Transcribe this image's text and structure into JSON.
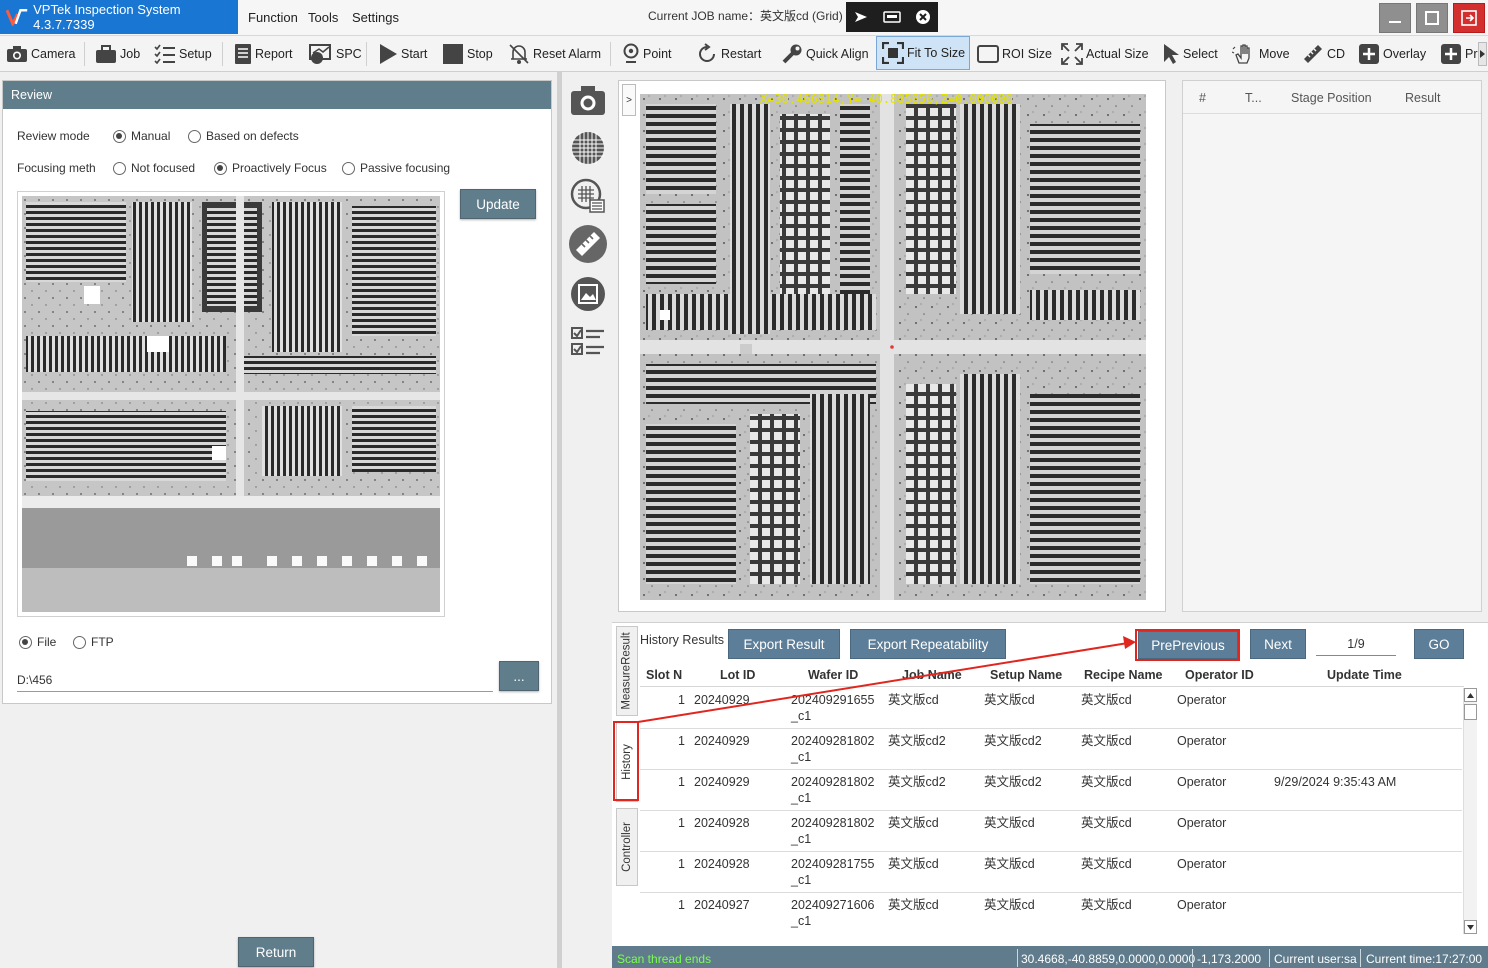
{
  "app": {
    "title": "VPTek Inspection System 4.3.7.7339",
    "menus": [
      "Function",
      "Tools",
      "Settings"
    ],
    "job_label": "Current JOB name：英文版cd (Grid)"
  },
  "toolbar": [
    {
      "id": "camera",
      "label": "Camera",
      "icon": "camera-icon"
    },
    {
      "id": "job",
      "label": "Job",
      "icon": "briefcase-icon"
    },
    {
      "id": "setup",
      "label": "Setup",
      "icon": "checklist-icon"
    },
    {
      "id": "report",
      "label": "Report",
      "icon": "report-icon"
    },
    {
      "id": "spc",
      "label": "SPC",
      "icon": "spc-icon"
    },
    {
      "id": "start",
      "label": "Start",
      "icon": "play-icon"
    },
    {
      "id": "stop",
      "label": "Stop",
      "icon": "stop-icon"
    },
    {
      "id": "reset_alarm",
      "label": "Reset Alarm",
      "icon": "bell-off-icon"
    },
    {
      "id": "point",
      "label": "Point",
      "icon": "pin-icon"
    },
    {
      "id": "restart",
      "label": "Restart",
      "icon": "restart-icon"
    },
    {
      "id": "quick_align",
      "label": "Quick Align",
      "icon": "wrench-icon"
    },
    {
      "id": "fit_to_size",
      "label": "Fit To Size",
      "icon": "fit-icon"
    },
    {
      "id": "roi_size",
      "label": "ROI Size",
      "icon": "rectangle-icon"
    },
    {
      "id": "actual_size",
      "label": "Actual Size",
      "icon": "expand-icon"
    },
    {
      "id": "select",
      "label": "Select",
      "icon": "cursor-icon"
    },
    {
      "id": "move",
      "label": "Move",
      "icon": "hand-icon"
    },
    {
      "id": "cd",
      "label": "CD",
      "icon": "ruler-icon"
    },
    {
      "id": "overlay",
      "label": "Overlay",
      "icon": "plus-icon"
    },
    {
      "id": "pr",
      "label": "Pr",
      "icon": "plus-icon"
    }
  ],
  "review": {
    "header": "Review",
    "review_mode_label": "Review mode",
    "review_mode_options": [
      "Manual",
      "Based on defects"
    ],
    "review_mode_selected": "Manual",
    "focusing_label": "Focusing meth",
    "focusing_options": [
      "Not focused",
      "Proactively Focus",
      "Passive focusing"
    ],
    "focusing_selected": "Proactively Focus",
    "update_button": "Update",
    "source_options": [
      "File",
      "FTP"
    ],
    "source_selected": "File",
    "path_value": "D:\\456",
    "browse_button": "...",
    "return_button": "Return"
  },
  "viewer": {
    "toggle_glyph": ">",
    "coord_overlay": "X=30.466814,Y=-40.885856,Z=0.000000"
  },
  "results_panel": {
    "columns": [
      "#",
      "T...",
      "Stage Position",
      "Result"
    ]
  },
  "history": {
    "title": "History Results",
    "export_result": "Export Result",
    "export_repeatability": "Export Repeatability",
    "previous": "PrePrevious",
    "next": "Next",
    "page": "1/9",
    "go": "GO",
    "side_tabs": [
      "MeasureResult",
      "History",
      "Controller"
    ],
    "columns": [
      "Slot N",
      "Lot ID",
      "Wafer ID",
      "Job Name",
      "Setup Name",
      "Recipe Name",
      "Operator ID",
      "Update Time"
    ],
    "rows": [
      {
        "slot": "1",
        "lot": "20240929",
        "wafer": "202409291655",
        "wafer2": "_c1",
        "job": "英文版cd",
        "setup": "英文版cd",
        "recipe": "英文版cd",
        "operator": "Operator",
        "time": ""
      },
      {
        "slot": "1",
        "lot": "20240929",
        "wafer": "202409281802",
        "wafer2": "_c1",
        "job": "英文版cd2",
        "setup": "英文版cd2",
        "recipe": "英文版cd",
        "operator": "Operator",
        "time": ""
      },
      {
        "slot": "1",
        "lot": "20240929",
        "wafer": "202409281802",
        "wafer2": "_c1",
        "job": "英文版cd2",
        "setup": "英文版cd2",
        "recipe": "英文版cd",
        "operator": "Operator",
        "time": "9/29/2024 9:35:43 AM"
      },
      {
        "slot": "1",
        "lot": "20240928",
        "wafer": "202409281802",
        "wafer2": "_c1",
        "job": "英文版cd",
        "setup": "英文版cd",
        "recipe": "英文版cd",
        "operator": "Operator",
        "time": ""
      },
      {
        "slot": "1",
        "lot": "20240928",
        "wafer": "202409281755",
        "wafer2": "_c1",
        "job": "英文版cd",
        "setup": "英文版cd",
        "recipe": "英文版cd",
        "operator": "Operator",
        "time": ""
      },
      {
        "slot": "1",
        "lot": "20240927",
        "wafer": "202409271606",
        "wafer2": "_c1",
        "job": "英文版cd",
        "setup": "英文版cd",
        "recipe": "英文版cd",
        "operator": "Operator",
        "time": ""
      }
    ]
  },
  "status": {
    "message": "Scan thread ends",
    "position": "30.4668,-40.8859,0.0000,0.0000",
    "value": "-1,173.2000",
    "user": "Current user:sa",
    "time": "Current time:17:27:00"
  },
  "colors": {
    "brand": "#1976d2",
    "panel_header": "#607d8b",
    "status_bar": "#5f7b8c",
    "highlight_red": "#e0261f",
    "status_message": "#7cff4f"
  }
}
